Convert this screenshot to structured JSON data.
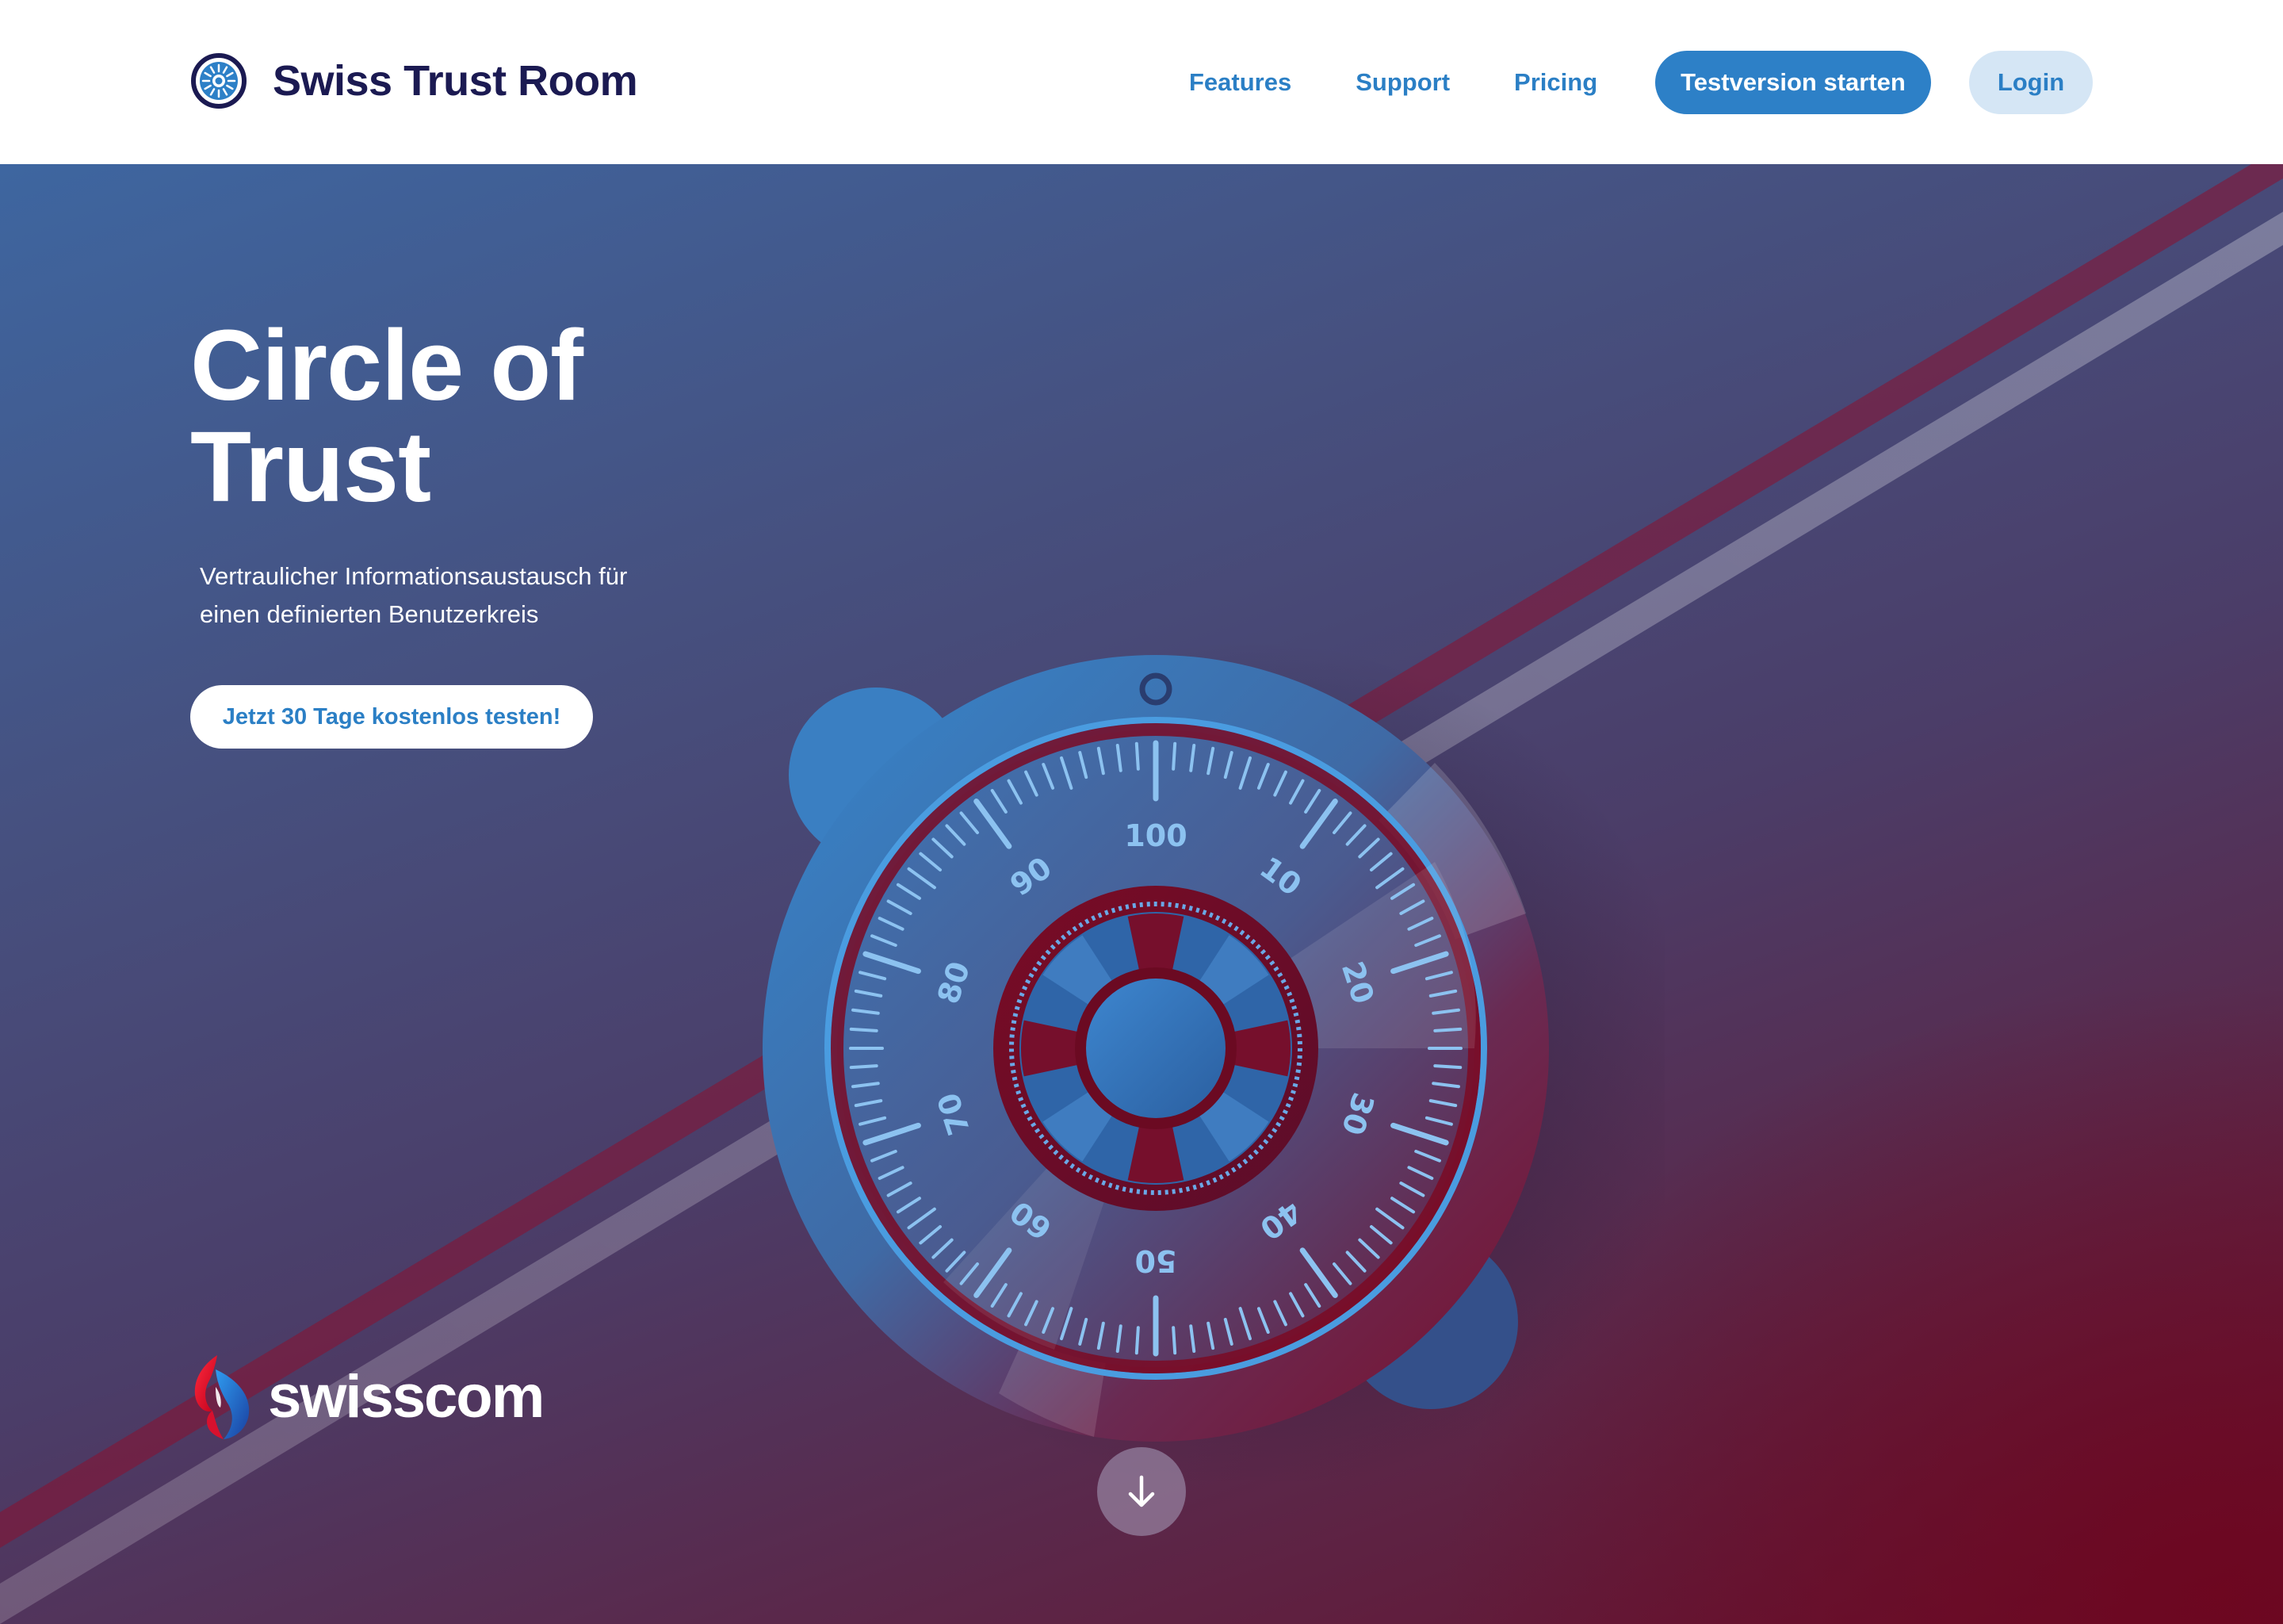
{
  "brand": {
    "name": "Swiss Trust Room",
    "logo_icon": "dial-logo-icon"
  },
  "nav": {
    "links": [
      "Features",
      "Support",
      "Pricing"
    ],
    "trial_button": "Testversion starten",
    "login_button": "Login"
  },
  "hero": {
    "title_line1": "Circle of",
    "title_line2": "Trust",
    "subtitle_line1": "Vertraulicher Informationsaustausch für",
    "subtitle_line2": "einen definierten Benutzerkreis",
    "cta": "Jetzt 30 Tage kostenlos testen!",
    "dial_numbers": [
      "100",
      "10",
      "20",
      "30",
      "40",
      "50",
      "60",
      "70",
      "80",
      "90"
    ]
  },
  "footer_brand": {
    "name": "swisscom",
    "icon": "swisscom-logo-icon"
  },
  "scroll_icon": "arrow-down-icon",
  "colors": {
    "brand_dark": "#1b1a52",
    "primary_blue": "#2d80c7",
    "login_bg": "#d5e6f5",
    "hero_blue": "#3e66a0",
    "hero_red": "#670f2b"
  }
}
